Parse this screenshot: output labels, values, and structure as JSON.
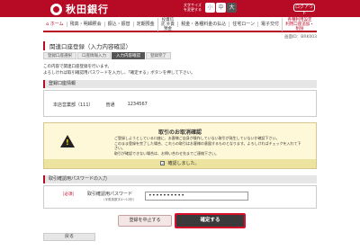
{
  "header": {
    "bank_name": "秋田銀行",
    "fontsize_label": "文字サイズを変更する",
    "fontsize_small": "小",
    "fontsize_mid": "中",
    "fontsize_large": "大",
    "logout_label": "ログアウト"
  },
  "nav": {
    "items": [
      "ホーム",
      "残高・明細照会",
      "振込・振替",
      "定期預金",
      "投資信託 外貨預金",
      "税金・各種料金の払込",
      "住宅ローン",
      "電子交付",
      "各種利用設定 利用口座追加・削除"
    ]
  },
  "session_id": "画面ID：BRK003",
  "page": {
    "title": "関連口座登録（入力内容確認）",
    "steps": [
      "登録口座選択",
      "口座情報入力",
      "入力内容確認",
      "登録完了"
    ],
    "active_step": 2,
    "intro_line1": "この内容で関連口座登録を行います。",
    "intro_line2": "よろしければ取引確認用パスワードを入力し、「確定する」ボタンを押して下さい。"
  },
  "account_section": {
    "heading": "登録口座情報",
    "branch": "本店営業部（111）",
    "type": "普通",
    "number": "1234567"
  },
  "confirm": {
    "title": "取引のお取消確認",
    "text_line1": "ご登録しようとしている口座に、お客様ご自身が操作していない取引が発生していないか確認下さい。",
    "text_line2": "このまま登録を完了した場合、これらの取引はお客様の意図するものとなります。よろしければチェックを入れて下さい。",
    "text_line3": "取引が確認できない場合は、お問い合わせ先までご連絡下さい。",
    "check_label": "確認しました。"
  },
  "password_section": {
    "heading": "取引確認用パスワードの入力",
    "required": "［必須］",
    "label": "取引確認用パスワード",
    "sub_label": "（半角英数字4～12桁）",
    "value": "••••••••••"
  },
  "buttons": {
    "cancel": "登録を中止する",
    "confirm": "確定する",
    "back": "戻る"
  }
}
